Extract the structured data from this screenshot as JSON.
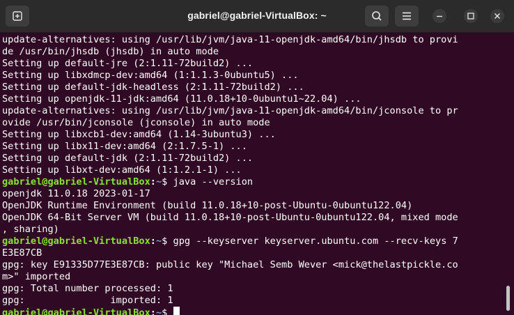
{
  "window": {
    "title": "gabriel@gabriel-VirtualBox: ~"
  },
  "titlebar": {
    "icons": {
      "new_tab": "new-tab-icon",
      "search": "search-icon",
      "menu": "hamburger-menu-icon",
      "minimize": "minimize-icon",
      "maximize": "maximize-icon",
      "close": "close-icon"
    }
  },
  "colors": {
    "terminal_bg": "#300a24",
    "titlebar_bg": "#2b2b2b",
    "prompt_user": "#8ae234",
    "prompt_path": "#729fcf",
    "text": "#ffffff"
  },
  "prompt": {
    "user_host": "gabriel@gabriel-VirtualBox",
    "sep": ":",
    "path": "~",
    "symbol": "$"
  },
  "terminal": {
    "lines": [
      "update-alternatives: using /usr/lib/jvm/java-11-openjdk-amd64/bin/jhsdb to provi",
      "de /usr/bin/jhsdb (jhsdb) in auto mode",
      "Setting up default-jre (2:1.11-72build2) ...",
      "Setting up libxdmcp-dev:amd64 (1:1.1.3-0ubuntu5) ...",
      "Setting up default-jdk-headless (2:1.11-72build2) ...",
      "Setting up openjdk-11-jdk:amd64 (11.0.18+10-0ubuntu1~22.04) ...",
      "update-alternatives: using /usr/lib/jvm/java-11-openjdk-amd64/bin/jconsole to pr",
      "ovide /usr/bin/jconsole (jconsole) in auto mode",
      "Setting up libxcb1-dev:amd64 (1.14-3ubuntu3) ...",
      "Setting up libx11-dev:amd64 (2:1.7.5-1) ...",
      "Setting up default-jdk (2:1.11-72build2) ...",
      "Setting up libxt-dev:amd64 (1:1.2.1-1) ...",
      "",
      "openjdk 11.0.18 2023-01-17",
      "OpenJDK Runtime Environment (build 11.0.18+10-post-Ubuntu-0ubuntu122.04)",
      "OpenJDK 64-Bit Server VM (build 11.0.18+10-post-Ubuntu-0ubuntu122.04, mixed mode",
      ", sharing)",
      "",
      "E3E87CB",
      "gpg: key E91335D77E3E87CB: public key \"Michael Semb Wever <mick@thelastpickle.co",
      "m>\" imported",
      "gpg: Total number processed: 1",
      "gpg:               imported: 1",
      ""
    ],
    "commands": {
      "cmd1": " java --version",
      "cmd2": " gpg --keyserver keyserver.ubuntu.com --recv-keys 7",
      "cmd3": " "
    }
  }
}
